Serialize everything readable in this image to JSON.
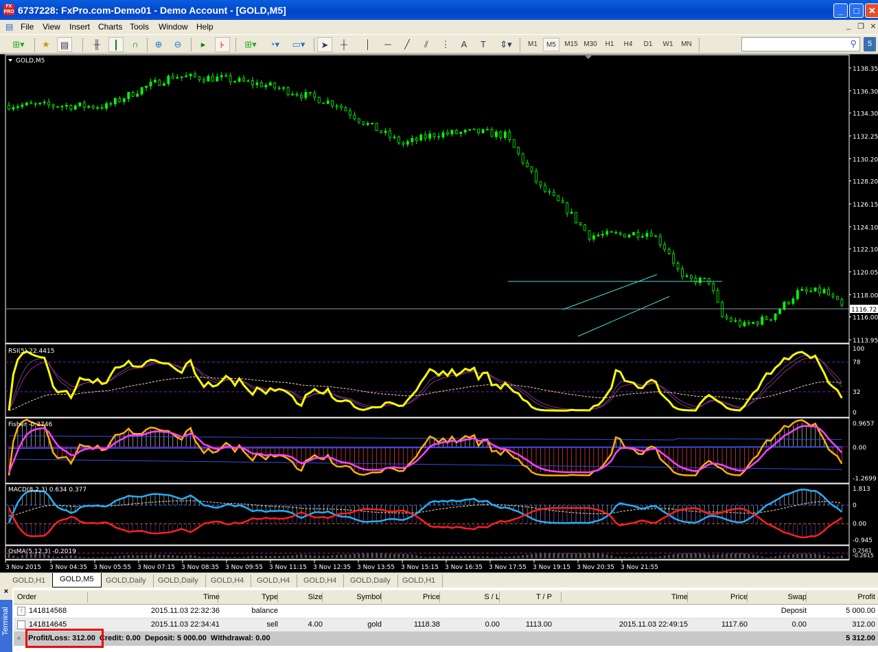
{
  "window": {
    "title": "6737228: FxPro.com-Demo01 - Demo Account - [GOLD,M5]",
    "logo": "FX PRO"
  },
  "menu": [
    "File",
    "View",
    "Insert",
    "Charts",
    "Tools",
    "Window",
    "Help"
  ],
  "timeframes": [
    "M1",
    "M5",
    "M15",
    "M30",
    "H1",
    "H4",
    "D1",
    "W1",
    "MN"
  ],
  "active_timeframe": "M5",
  "search": {
    "value": "",
    "placeholder": ""
  },
  "chart": {
    "symbol_label": "GOLD,M5",
    "price_ticks": [
      "1138.35",
      "1136.30",
      "1134.30",
      "1132.25",
      "1130.20",
      "1128.20",
      "1126.15",
      "1124.10",
      "1122.10",
      "1120.05",
      "1118.00",
      "1116.00",
      "1113.95"
    ],
    "current_price": "1116.72",
    "bull_color": "#00ff00",
    "approx_close_path": [
      [
        0,
        1135.0
      ],
      [
        6,
        1135.0
      ],
      [
        22,
        1134.9
      ],
      [
        30,
        1136.5
      ],
      [
        37,
        1137.6
      ],
      [
        48,
        1137.4
      ],
      [
        58,
        1136.8
      ],
      [
        64,
        1136.2
      ],
      [
        74,
        1135.1
      ],
      [
        80,
        1133.5
      ],
      [
        89,
        1131.5
      ],
      [
        96,
        1132.4
      ],
      [
        106,
        1132.6
      ],
      [
        112,
        1132.3
      ],
      [
        116,
        1130.0
      ],
      [
        120,
        1127.6
      ],
      [
        126,
        1125.6
      ],
      [
        131,
        1123.3
      ],
      [
        138,
        1123.4
      ],
      [
        145,
        1123.6
      ],
      [
        149,
        1121.8
      ],
      [
        152,
        1119.4
      ],
      [
        158,
        1119.2
      ],
      [
        161,
        1116.0
      ],
      [
        166,
        1115.2
      ],
      [
        172,
        1116.0
      ],
      [
        178,
        1118.2
      ],
      [
        184,
        1118.3
      ],
      [
        188,
        1116.9
      ]
    ],
    "time_labels": [
      "3 Nov 2015",
      "3 Nov 04:35",
      "3 Nov 05:55",
      "3 Nov 07:15",
      "3 Nov 08:35",
      "3 Nov 09:55",
      "3 Nov 11:15",
      "3 Nov 12:35",
      "3 Nov 13:55",
      "3 Nov 15:15",
      "3 Nov 16:35",
      "3 Nov 17:55",
      "3 Nov 19:15",
      "3 Nov 20:35",
      "3 Nov 21:55"
    ],
    "rsi": {
      "label": "RSI(5) 22.4415",
      "ticks": [
        "100",
        "78",
        "32",
        "0"
      ]
    },
    "fisher": {
      "label": "Fisher -0.2746",
      "ticks": [
        "0.9657",
        "0.00",
        "-1.2699"
      ]
    },
    "macd": {
      "label": "MACD(8,2,3) 0.634 0.377",
      "ticks": [
        "1.813",
        "0",
        "0.00",
        "-0.945"
      ]
    },
    "osma": {
      "label": "OsMA(5,12,3) -0.2019",
      "ticks": [
        "0.2561",
        "-0.2615"
      ]
    }
  },
  "chart_tabs": [
    "GOLD,H1",
    "GOLD,M5",
    "GOLD,Daily",
    "GOLD,Daily",
    "GOLD,H4",
    "GOLD,H4",
    "GOLD,H4",
    "GOLD,Daily",
    "GOLD,H1"
  ],
  "active_chart_tab": 1,
  "terminal": {
    "side_label": "Terminal",
    "columns": [
      "Order",
      "Time",
      "Type",
      "Size",
      "Symbol",
      "Price",
      "S / L",
      "T / P",
      "Time",
      "Price",
      "Swap",
      "Profit"
    ],
    "rows": [
      {
        "order": "141814568",
        "time": "2015.11.03 22:32:36",
        "type": "balance",
        "size": "",
        "symbol": "",
        "price": "",
        "sl": "",
        "tp": "",
        "close_time": "",
        "close_price": "",
        "swap": "Deposit",
        "profit": "5 000.00"
      },
      {
        "order": "141814645",
        "time": "2015.11.03 22:34:41",
        "type": "sell",
        "size": "4.00",
        "symbol": "gold",
        "price": "1118.38",
        "sl": "0.00",
        "tp": "1113.00",
        "close_time": "2015.11.03 22:49:15",
        "close_price": "1117.60",
        "swap": "0.00",
        "profit": "312.00"
      }
    ],
    "summary": {
      "text": "Profit/Loss: 312.00  Credit: 0.00  Deposit: 5 000.00  Withdrawal: 0.00",
      "total": "5 312.00"
    }
  }
}
